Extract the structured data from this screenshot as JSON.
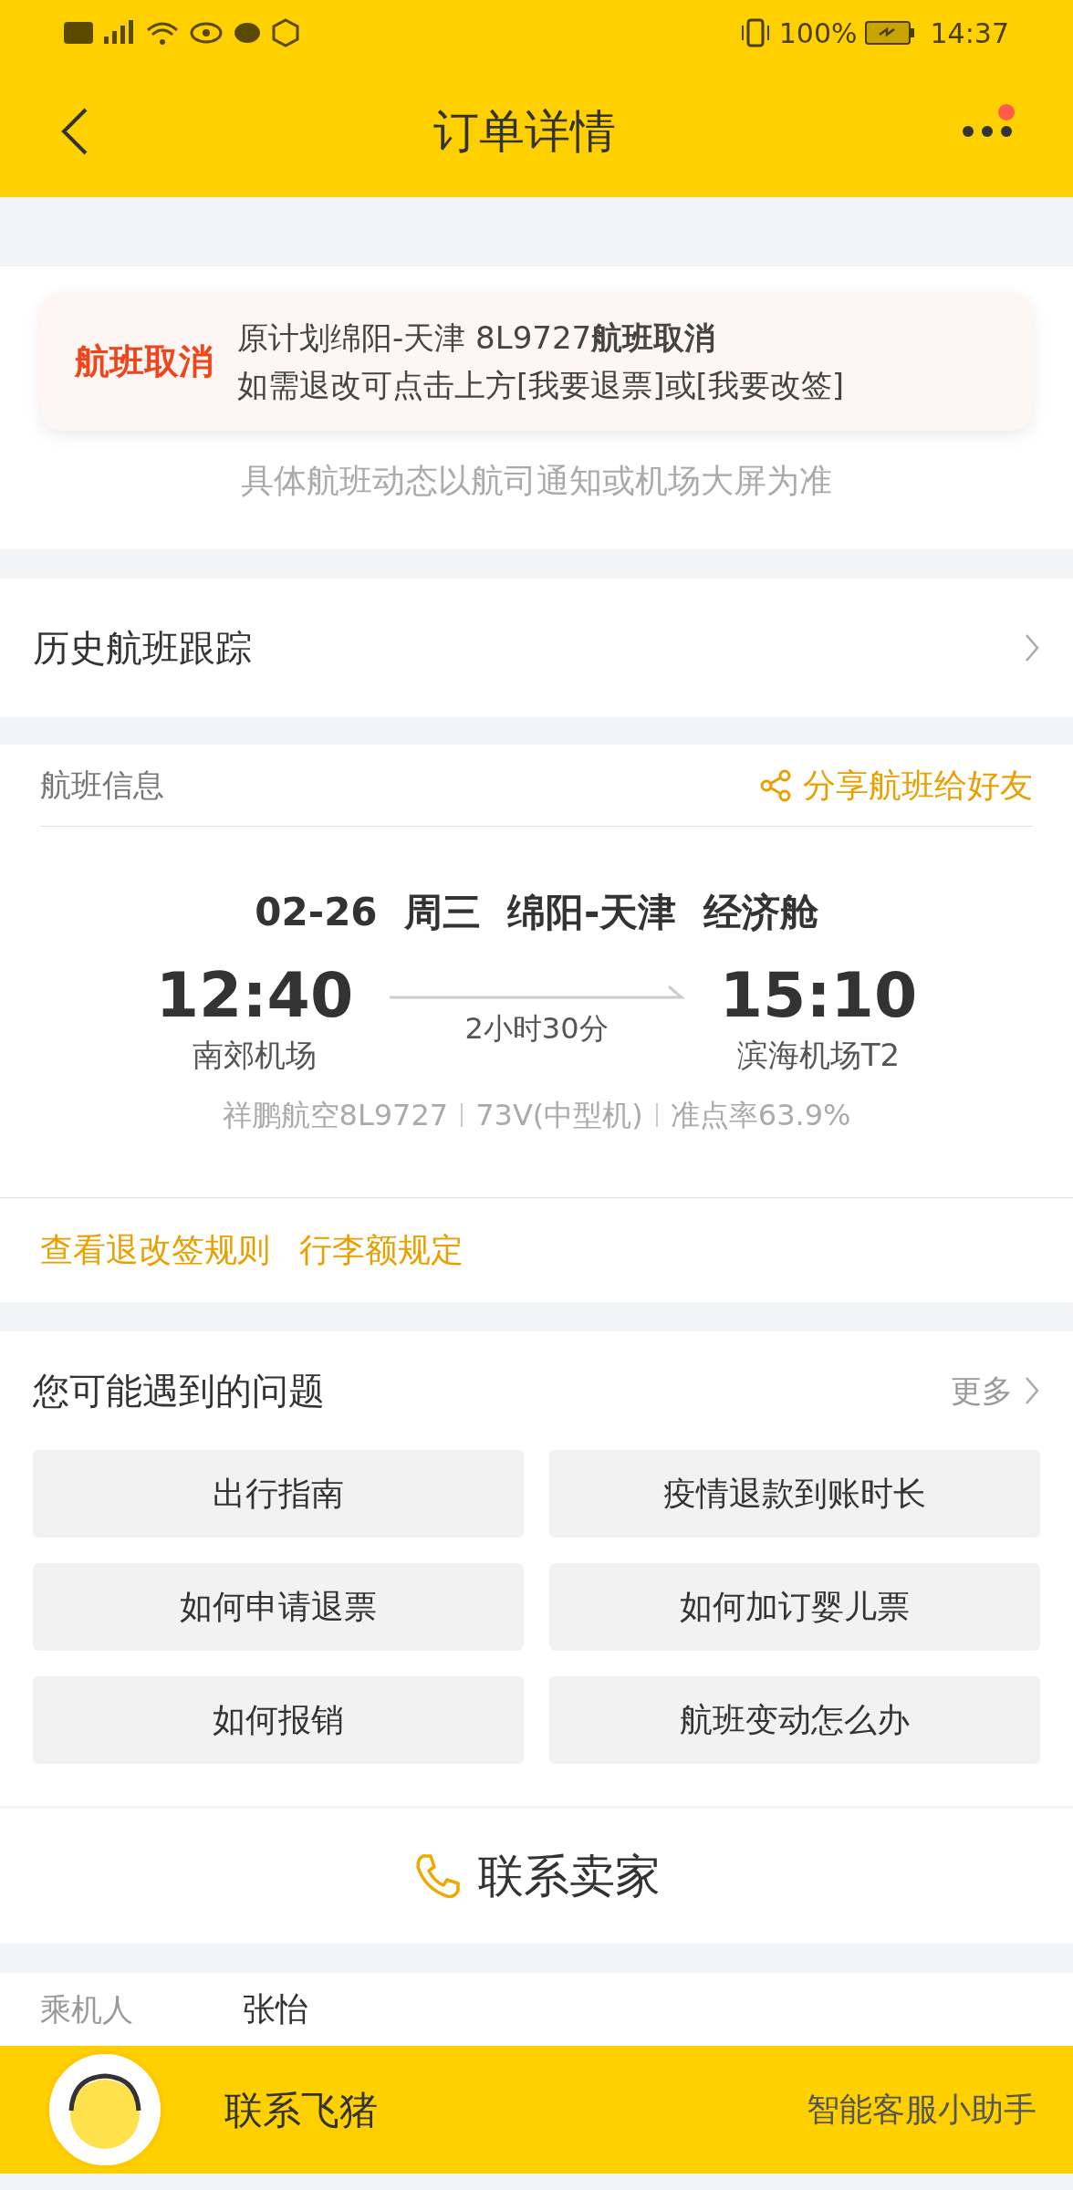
{
  "status_bar": {
    "battery": "100%",
    "time": "14:37"
  },
  "nav": {
    "title": "订单详情",
    "has_notification": true
  },
  "alert": {
    "badge": "航班取消",
    "line_1": "原计划绵阳-天津 8L9727**航班取消**",
    "line_2": "如需退改可点击上方[我要退票]或[我要改签]",
    "note": "具体航班动态以航司通知或机场大屏为准"
  },
  "history": {
    "label": "历史航班跟踪"
  },
  "flight": {
    "section_title": "航班信息",
    "share": "分享航班给好友",
    "summary": "02-26  周三  绵阳-天津  经济舱",
    "depart_time": "12:40",
    "depart_airport": "南郊机场",
    "duration": "2小时30分",
    "arrive_time": "15:10",
    "arrive_airport": "滨海机场T2",
    "details": [
      "祥鹏航空8L9727",
      "73V(中型机)",
      "准点率63.9%"
    ]
  },
  "links": [
    "查看退改签规则",
    "行李额规定"
  ],
  "questions": {
    "title": "您可能遇到的问题",
    "more": "更多",
    "items": [
      "出行指南",
      "疫情退款到账时长",
      "如何申请退票",
      "如何加订婴儿票",
      "如何报销",
      "航班变动怎么办"
    ]
  },
  "contact_seller": "联系卖家",
  "passenger": {
    "label": "乘机人",
    "name": "张怡"
  },
  "bottom_bar": {
    "title": "联系飞猪",
    "subtitle": "智能客服小助手"
  }
}
